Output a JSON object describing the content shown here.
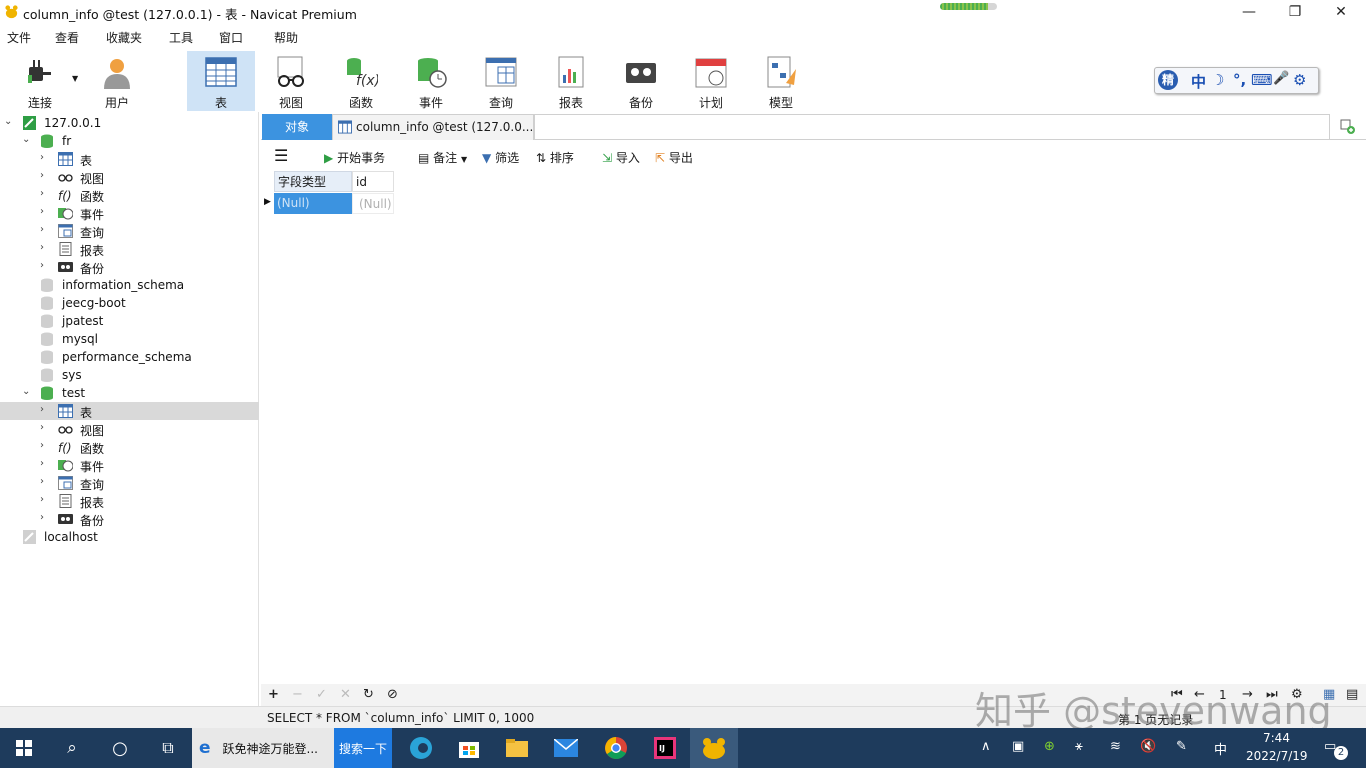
{
  "window": {
    "title": "column_info @test (127.0.0.1) - 表 - Navicat Premium",
    "progress": 0.85
  },
  "menu": [
    "文件",
    "查看",
    "收藏夹",
    "工具",
    "窗口",
    "帮助"
  ],
  "toolbar": {
    "connect": "连接",
    "user": "用户",
    "table": "表",
    "view": "视图",
    "function": "函数",
    "event": "事件",
    "query": "查询",
    "report": "报表",
    "backup": "备份",
    "schedule": "计划",
    "model": "模型"
  },
  "ime": {
    "logo": "精",
    "lang": "中",
    "moon": "☽",
    "punct": "°,",
    "kb": "⌨",
    "mic": "🎤",
    "gear": "⚙"
  },
  "tree": {
    "conn1": "127.0.0.1",
    "fr": {
      "name": "fr",
      "items": [
        "表",
        "视图",
        "函数",
        "事件",
        "查询",
        "报表",
        "备份"
      ]
    },
    "dbs": [
      "information_schema",
      "jeecg-boot",
      "jpatest",
      "mysql",
      "performance_schema",
      "sys"
    ],
    "test": {
      "name": "test",
      "items": [
        "表",
        "视图",
        "函数",
        "事件",
        "查询",
        "报表",
        "备份"
      ]
    },
    "conn2": "localhost"
  },
  "tabs": {
    "objects": "对象",
    "file": "column_info @test (127.0.0...."
  },
  "subtoolbar": {
    "begin_tx": "开始事务",
    "memo": "备注",
    "filter": "筛选",
    "sort": "排序",
    "import": "导入",
    "export": "导出"
  },
  "grid": {
    "columns": [
      "字段类型",
      "id"
    ],
    "rows": [
      [
        "(Null)",
        "(Null)"
      ]
    ]
  },
  "bottom": {
    "page": "1",
    "records": "第 1 页无记录"
  },
  "status": {
    "sql": "SELECT * FROM `column_info` LIMIT 0, 1000"
  },
  "watermark": "知乎 @stevenwang",
  "taskbar": {
    "search_app": "跃免神途万能登...",
    "search_btn": "搜索一下",
    "time": "7:44",
    "date": "2022/7/19",
    "notif": "2",
    "ime_tray": "中"
  },
  "colors": {
    "accent": "#3c93e0",
    "selection": "#cfe3f6",
    "taskbar": "#1e3b5c"
  }
}
